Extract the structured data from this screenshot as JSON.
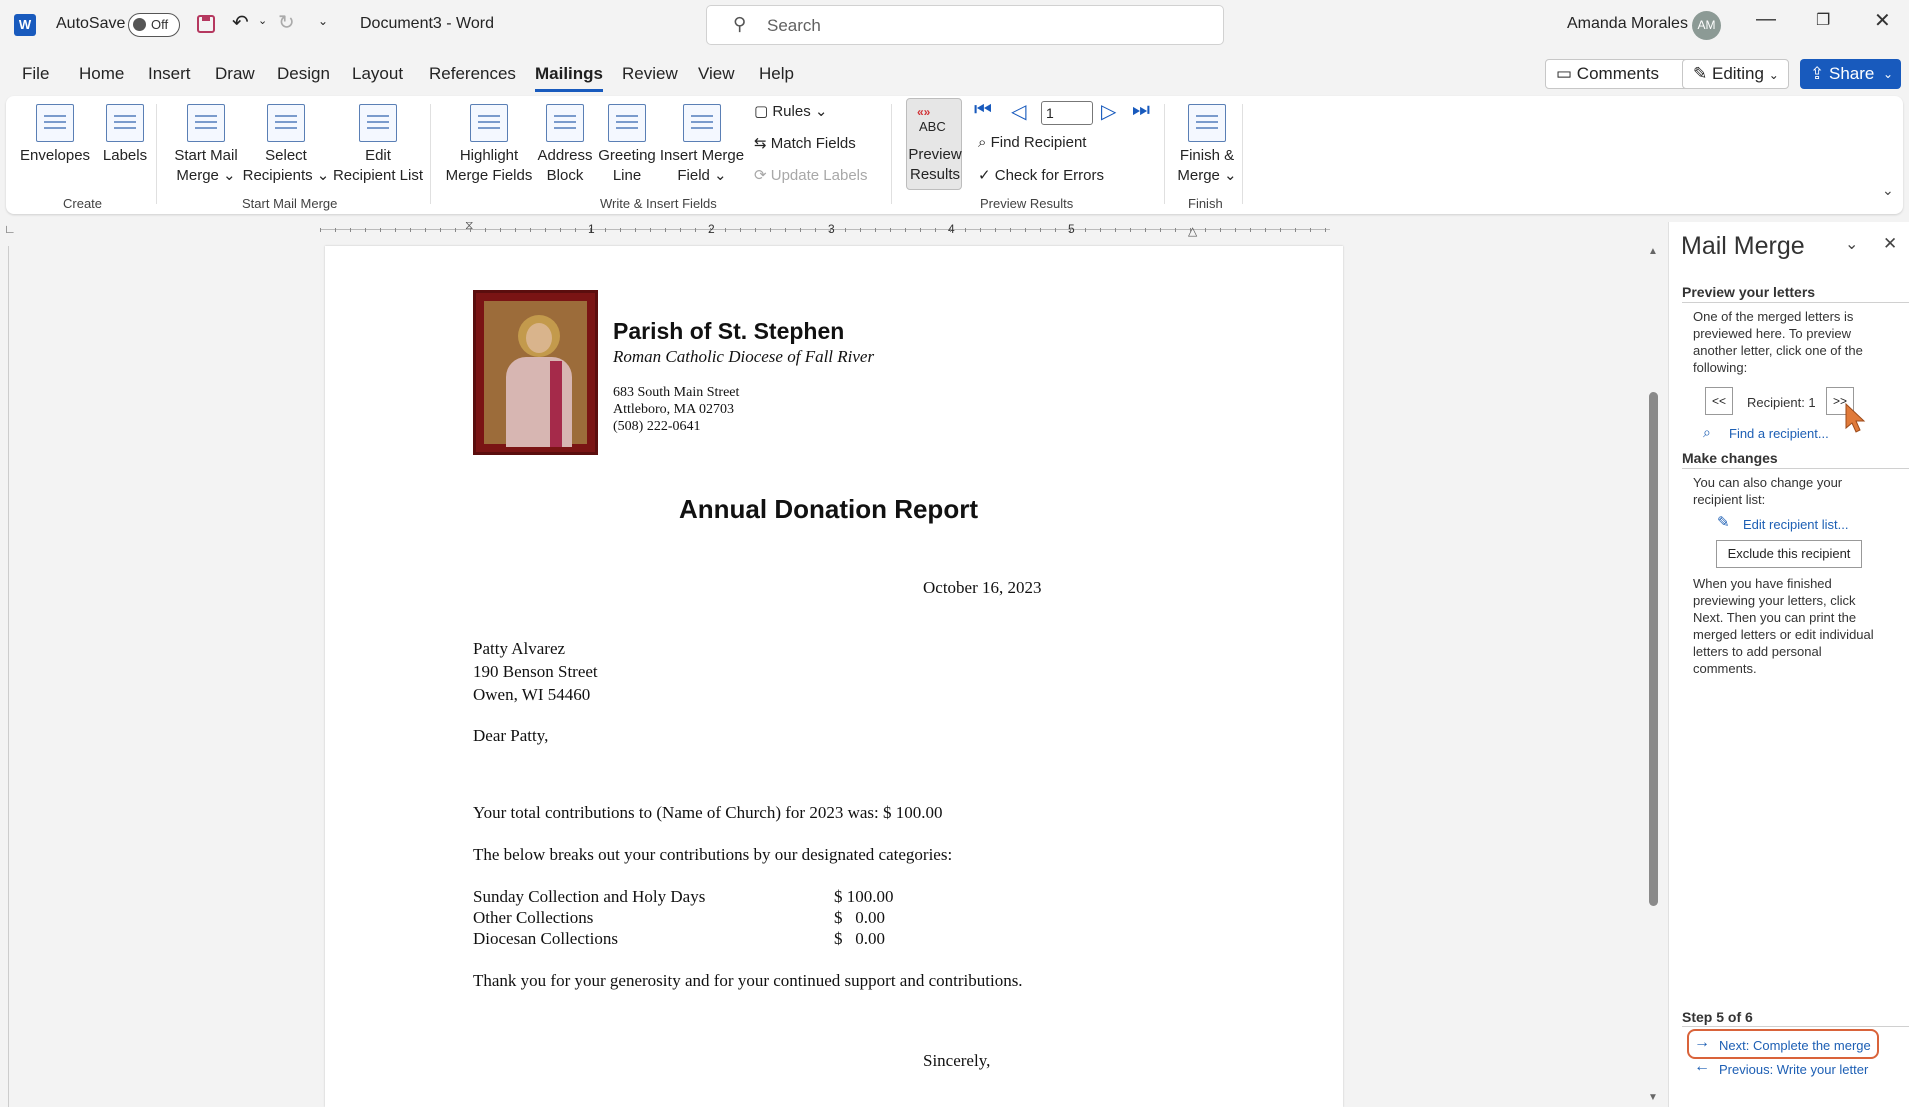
{
  "titlebar": {
    "autosave_label": "AutoSave",
    "autosave_state": "Off",
    "doc_title": "Document3  -  Word",
    "search_placeholder": "Search",
    "user_name": "Amanda Morales",
    "user_initials": "AM"
  },
  "menu": {
    "tabs": [
      "File",
      "Home",
      "Insert",
      "Draw",
      "Design",
      "Layout",
      "References",
      "Mailings",
      "Review",
      "View",
      "Help"
    ],
    "comments_label": "Comments",
    "editing_label": "Editing",
    "share_label": "Share"
  },
  "ribbon": {
    "envelopes": "Envelopes",
    "labels": "Labels",
    "start_mail_merge": [
      "Start Mail",
      "Merge ⌄"
    ],
    "select_recipients": [
      "Select",
      "Recipients ⌄"
    ],
    "edit_recipient_list": [
      "Edit",
      "Recipient List"
    ],
    "highlight_merge_fields": [
      "Highlight",
      "Merge Fields"
    ],
    "address_block": [
      "Address",
      "Block"
    ],
    "greeting_line": [
      "Greeting",
      "Line"
    ],
    "insert_merge_field": [
      "Insert Merge",
      "Field ⌄"
    ],
    "rules": "Rules ⌄",
    "match_fields": "Match Fields",
    "update_labels": "Update Labels",
    "preview_results": [
      "Preview",
      "Results"
    ],
    "preview_abc": "ABC",
    "record_number": "1",
    "find_recipient": "Find Recipient",
    "check_for_errors": "Check for Errors",
    "finish_merge": [
      "Finish &",
      "Merge ⌄"
    ],
    "groups": {
      "create": "Create",
      "start_mail_merge": "Start Mail Merge",
      "write_insert": "Write & Insert Fields",
      "preview_results": "Preview Results",
      "finish": "Finish"
    }
  },
  "ruler": {
    "numbers": [
      "1",
      "2",
      "3",
      "4",
      "5"
    ]
  },
  "document": {
    "parish_name": "Parish of St. Stephen",
    "diocese": "Roman Catholic Diocese of Fall River",
    "address1": "683 South Main Street",
    "address2": "Attleboro, MA 02703",
    "phone": "(508) 222-0641",
    "report_title": "Annual Donation Report",
    "date": "October 16, 2023",
    "recipient_name": " Patty Alvarez",
    "recipient_street": "190 Benson Street",
    "recipient_city": "Owen, WI  54460",
    "greeting": "Dear Patty,",
    "total_line": "Your total contributions to (Name of Church) for 2023 was:  $ 100.00",
    "breakout_line": "The below breaks out your contributions by our designated categories:",
    "categories": [
      {
        "name": "Sunday Collection and Holy Days",
        "amount": "$ 100.00"
      },
      {
        "name": "Other Collections",
        "amount": "$   0.00"
      },
      {
        "name": "Diocesan Collections",
        "amount": "$   0.00"
      }
    ],
    "thanks": "Thank you for your generosity and for your continued support and contributions.",
    "closing": "Sincerely,"
  },
  "pane": {
    "title": "Mail Merge",
    "preview_heading": "Preview your letters",
    "preview_text": [
      "One of the merged letters is",
      "previewed here. To preview",
      "another letter, click one of the",
      "following:"
    ],
    "prev_btn": "<<",
    "recipient_label": "Recipient: 1",
    "next_btn": ">>",
    "find_recipient": "Find a recipient...",
    "make_changes_heading": "Make changes",
    "make_changes_text": [
      "You can also change your",
      "recipient list:"
    ],
    "edit_recipient_list": "Edit recipient list...",
    "exclude_recipient": "Exclude this recipient",
    "finished_text": [
      "When you have finished",
      "previewing your letters, click",
      "Next. Then you can print the",
      "merged letters or edit individual",
      "letters to add personal",
      "comments."
    ],
    "step_label": "Step 5 of 6",
    "next_step": "Next: Complete the merge",
    "previous_step": "Previous: Write your letter"
  }
}
